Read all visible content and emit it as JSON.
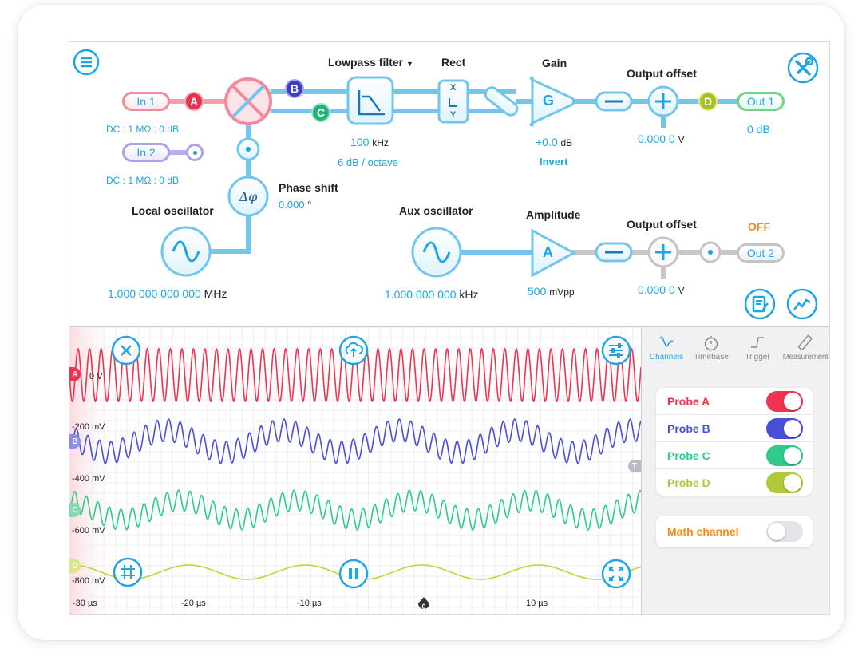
{
  "diagram": {
    "inputs": [
      {
        "label": "In 1",
        "tag": "A",
        "info": "DC : 1 MΩ : 0 dB"
      },
      {
        "label": "In 2",
        "info": "DC : 1 MΩ : 0 dB"
      }
    ],
    "mixer_tags": [
      "B",
      "C"
    ],
    "lowpass": {
      "title": "Lowpass filter",
      "freq_value": "100",
      "freq_unit": "kHz",
      "slope": "6 dB / octave"
    },
    "rect": {
      "title": "Rect",
      "x": "X",
      "y": "Y"
    },
    "gain": {
      "title": "Gain",
      "symbol": "G",
      "value": "+0.0",
      "unit": "dB",
      "invert": "Invert"
    },
    "output_offset_1": {
      "title": "Output offset",
      "value": "0.000 0",
      "unit": "V",
      "tag": "D"
    },
    "out1": {
      "label": "Out 1",
      "value": "0 dB"
    },
    "phase_shift": {
      "title": "Phase shift",
      "value": "0.000",
      "unit": "°"
    },
    "local_oscillator": {
      "title": "Local oscillator",
      "value": "1.000 000 000 000",
      "unit": "MHz"
    },
    "aux_oscillator": {
      "title": "Aux oscillator",
      "value": "1.000 000 000",
      "unit": "kHz"
    },
    "amplitude": {
      "title": "Amplitude",
      "symbol": "A",
      "value": "500",
      "unit": "mVpp"
    },
    "output_offset_2": {
      "title": "Output offset",
      "value": "0.000 0",
      "unit": "V"
    },
    "out2": {
      "label": "Out 2",
      "status": "OFF"
    },
    "icons": [
      "menu-icon",
      "tools-icon",
      "notes-icon",
      "chart-icon"
    ]
  },
  "scope": {
    "y_labels": [
      "0 V",
      "-200 mV",
      "-400 mV",
      "-600 mV",
      "-800 mV"
    ],
    "x_labels": [
      "-30 µs",
      "-20 µs",
      "-10 µs",
      "0",
      "10 µs"
    ],
    "channel_markers": [
      "A",
      "B",
      "C",
      "D"
    ],
    "trigger_marker": "T",
    "colors": {
      "A": "#f0334e",
      "B": "#4a4fd8",
      "C": "#2ecb8a",
      "D": "#c3d43a",
      "accent": "#1fa5e3"
    }
  },
  "panel": {
    "tabs": [
      {
        "label": "Channels",
        "icon": "channels-wave-icon",
        "active": true
      },
      {
        "label": "Timebase",
        "icon": "stopwatch-icon",
        "active": false
      },
      {
        "label": "Trigger",
        "icon": "trigger-step-icon",
        "active": false
      },
      {
        "label": "Measurement",
        "icon": "ruler-icon",
        "active": false
      }
    ],
    "probes": [
      {
        "label": "Probe A",
        "color": "#f0334e",
        "on": true
      },
      {
        "label": "Probe B",
        "color": "#4a4fd8",
        "on": true
      },
      {
        "label": "Probe C",
        "color": "#2ecb8a",
        "on": true
      },
      {
        "label": "Probe D",
        "color": "#b0c93a",
        "on": true
      }
    ],
    "math": {
      "label": "Math channel",
      "color": "#ff8a1f",
      "on": false
    }
  }
}
